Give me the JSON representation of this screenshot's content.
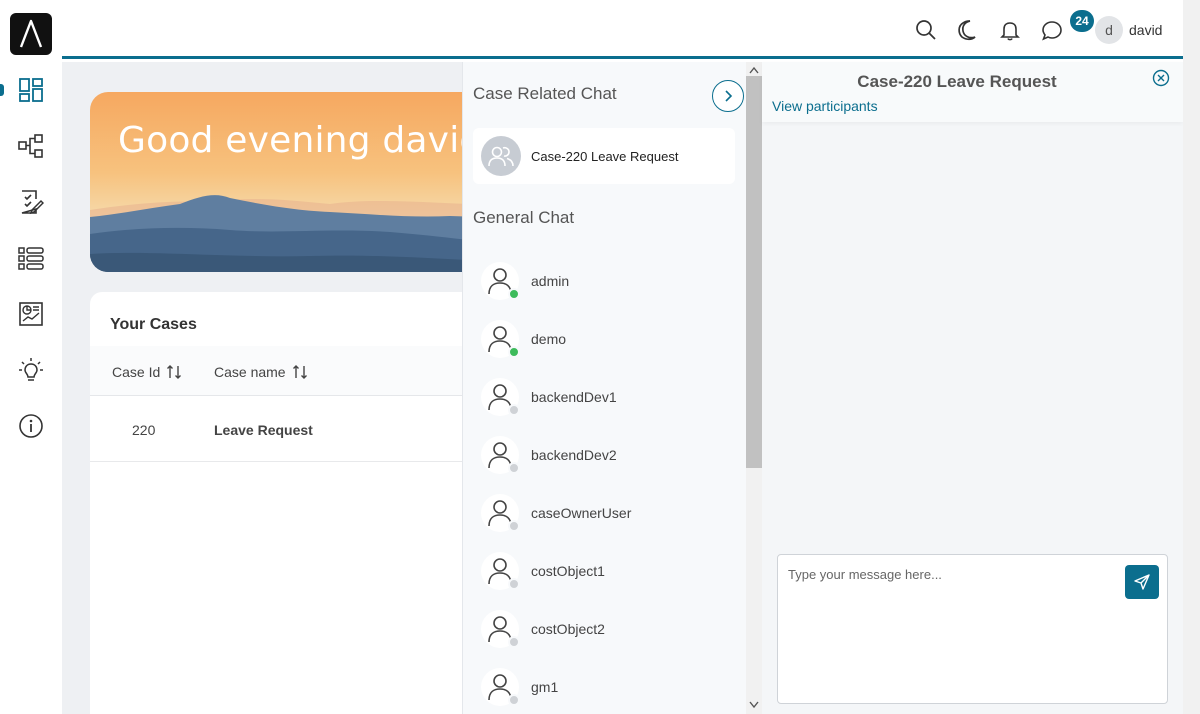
{
  "app": {
    "logo_glyph": "Λ",
    "accent": "#0b6e8e"
  },
  "nav": {
    "items": [
      {
        "name": "dashboard-icon"
      },
      {
        "name": "process-flow-icon"
      },
      {
        "name": "task-checklist-icon"
      },
      {
        "name": "list-icon"
      },
      {
        "name": "report-icon"
      },
      {
        "name": "idea-bulb-icon"
      },
      {
        "name": "info-icon"
      }
    ]
  },
  "topbar": {
    "notification_count": "24",
    "user": {
      "initial": "d",
      "name": "david"
    },
    "icons": [
      "search-icon",
      "moon-icon",
      "bell-icon",
      "chat-icon"
    ]
  },
  "dashboard": {
    "greeting": "Good evening david, w",
    "cases": {
      "title": "Your Cases",
      "columns": [
        "Case Id",
        "Case name"
      ],
      "rows": [
        {
          "id": "220",
          "name": "Leave Request"
        }
      ]
    }
  },
  "chat": {
    "case_section_title": "Case Related Chat",
    "case_chat": {
      "label": "Case-220 Leave Request"
    },
    "general_section_title": "General Chat",
    "users": [
      {
        "name": "admin",
        "online": true
      },
      {
        "name": "demo",
        "online": true
      },
      {
        "name": "backendDev1",
        "online": false
      },
      {
        "name": "backendDev2",
        "online": false
      },
      {
        "name": "caseOwnerUser",
        "online": false
      },
      {
        "name": "costObject1",
        "online": false
      },
      {
        "name": "costObject2",
        "online": false
      },
      {
        "name": "gm1",
        "online": false
      }
    ],
    "status_colors": {
      "online": "#3dbb5b",
      "offline": "#cfd2d6"
    }
  },
  "conversation": {
    "title": "Case-220 Leave Request",
    "view_participants": "View participants",
    "message_placeholder": "Type your message here..."
  }
}
